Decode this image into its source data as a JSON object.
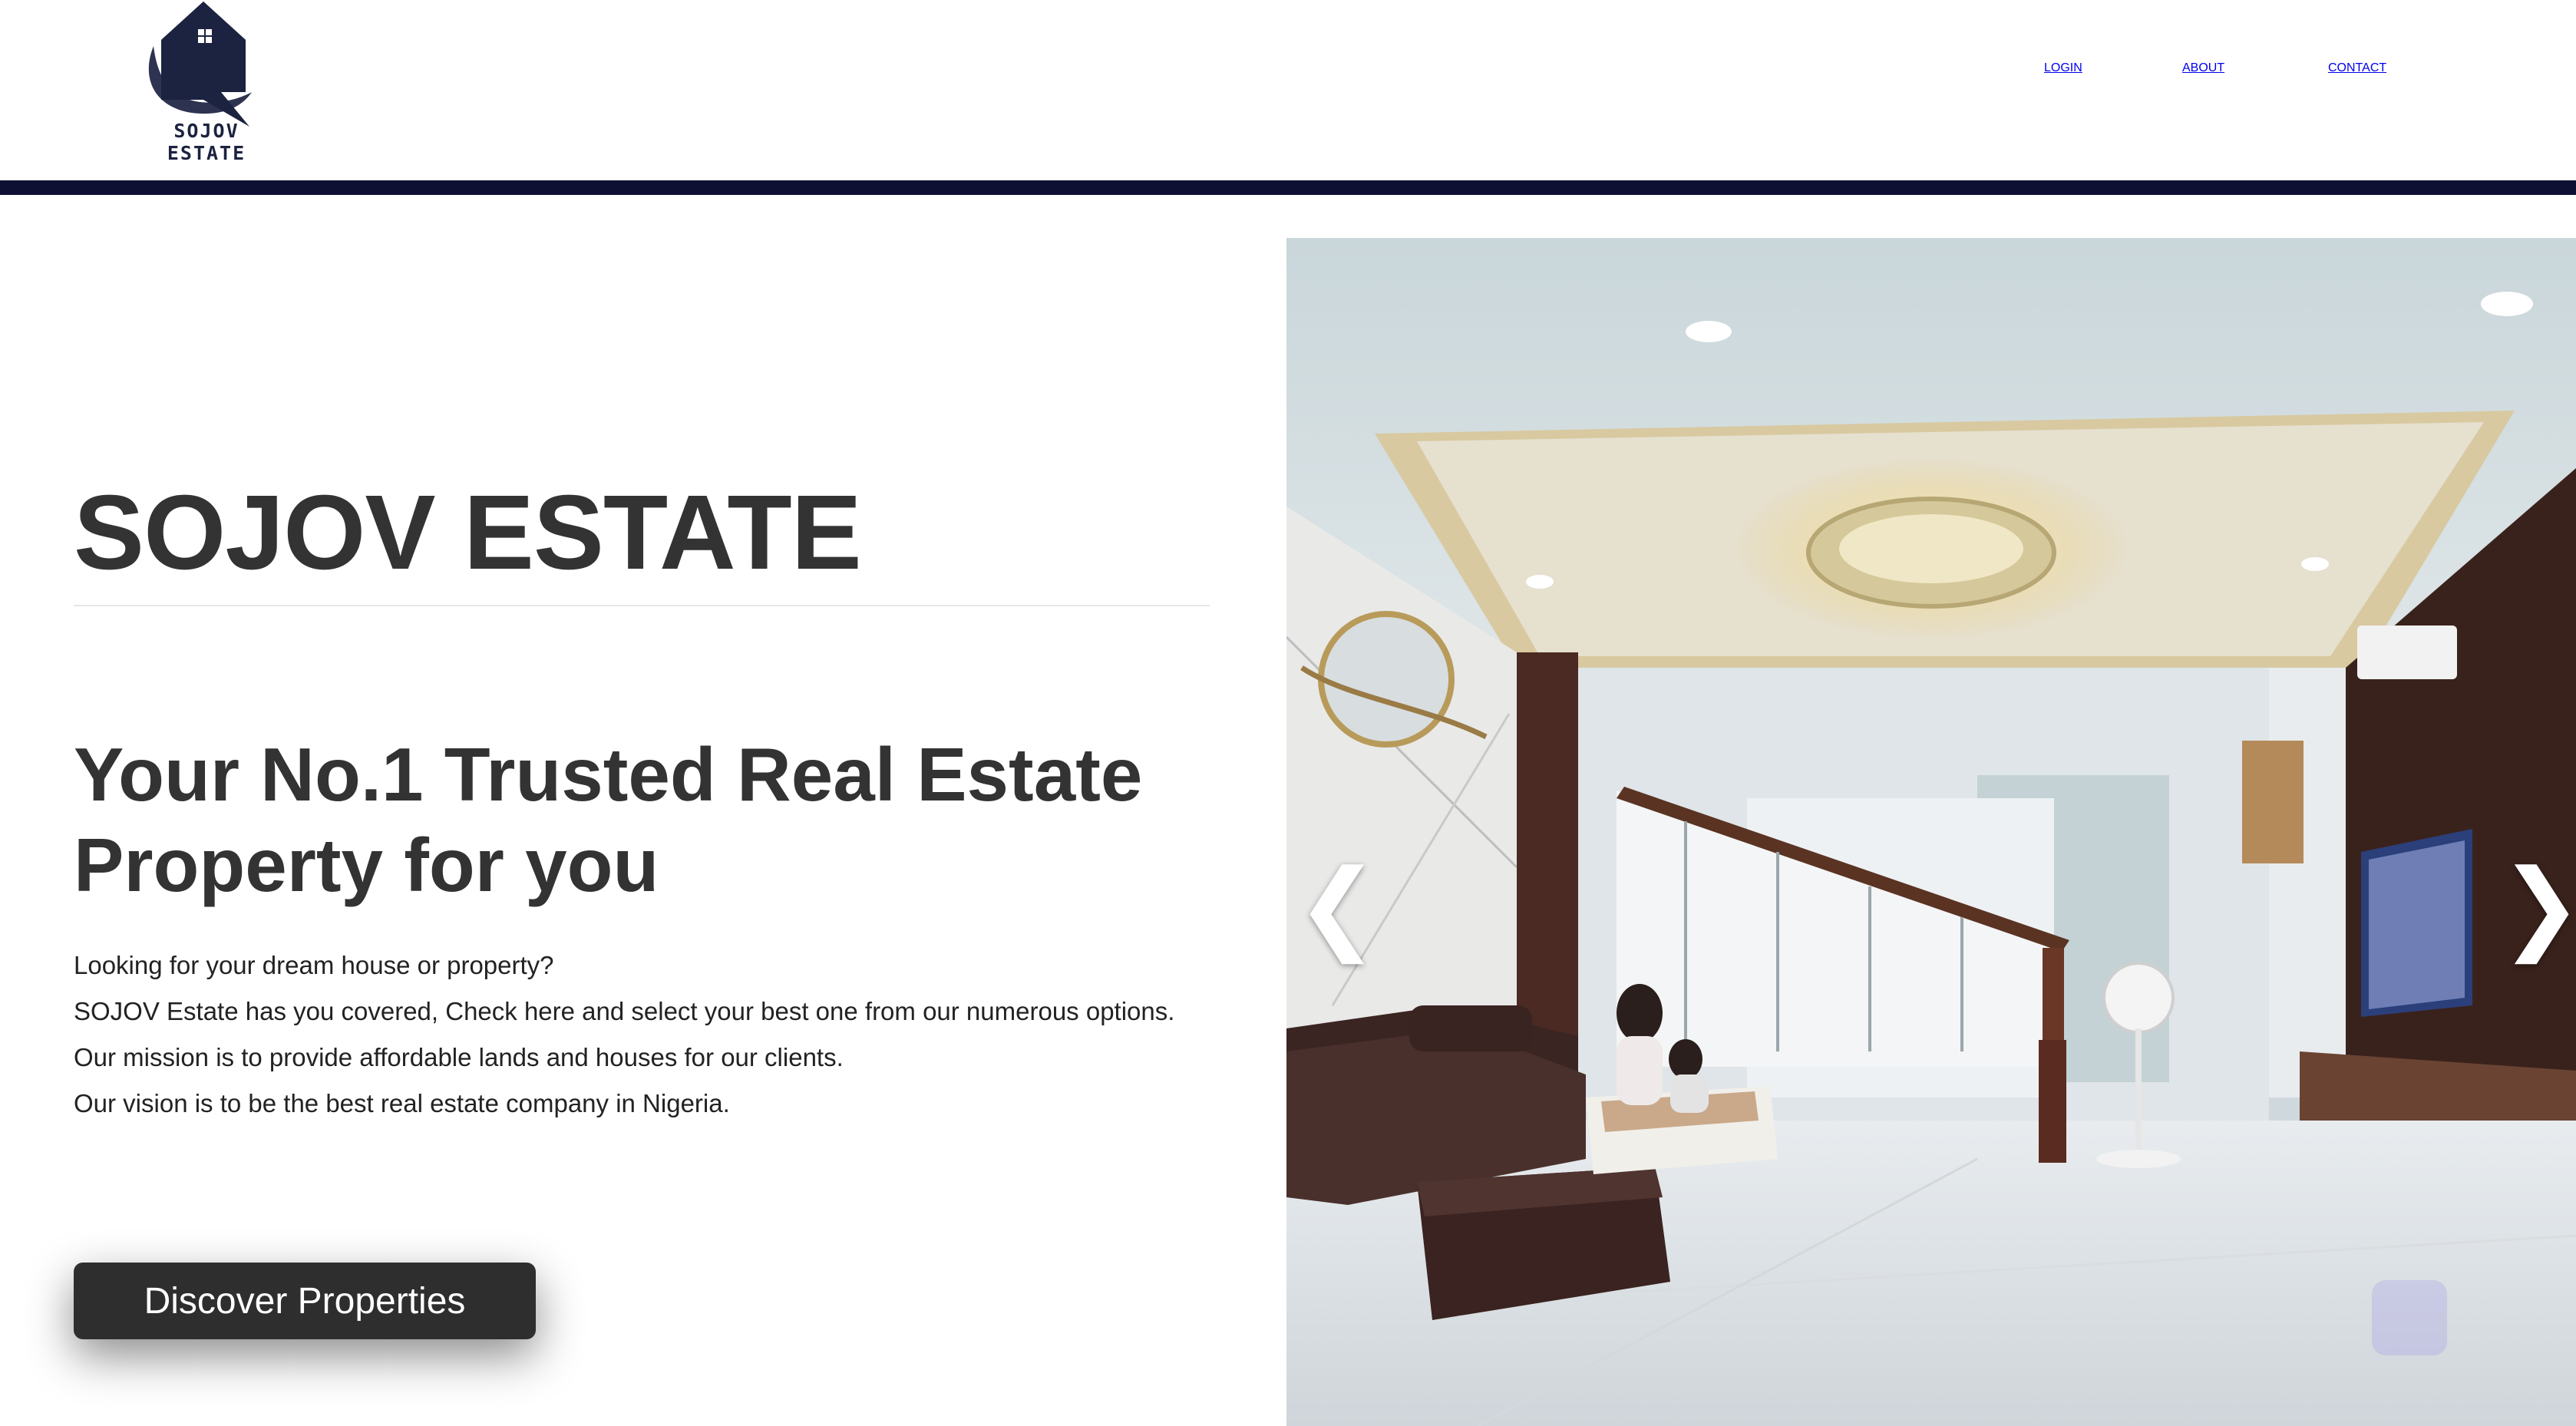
{
  "brand": {
    "logo_text": "SOJOV ESTATE",
    "color": "#1c2340"
  },
  "nav": {
    "login": "LOGIN",
    "about": "ABOUT",
    "contact": "CONTACT"
  },
  "hero": {
    "title": "SOJOV ESTATE",
    "tagline": "Your No.1 Trusted Real Estate Property for you",
    "paragraphs": [
      "Looking for your dream house or property?",
      "SOJOV Estate has you covered, Check here and select your best one from our numerous options.",
      "Our mission is to provide affordable lands and houses for our clients.",
      "Our vision is to be the best real estate company in Nigeria."
    ],
    "cta_label": "Discover Properties"
  },
  "carousel": {
    "prev_icon": "chevron-left-icon",
    "next_icon": "chevron-right-icon",
    "prev_glyph": "❮",
    "next_glyph": "❯"
  },
  "colors": {
    "header_bar": "#0e1033",
    "button": "#2e2e2e"
  }
}
